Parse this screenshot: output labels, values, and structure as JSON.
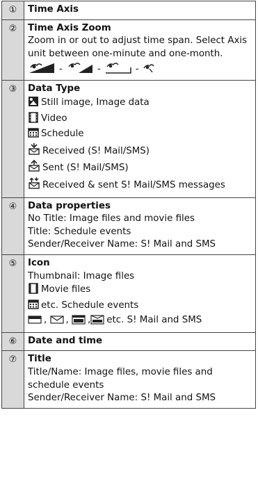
{
  "rows": [
    {
      "num": "①",
      "title": "Time Axis"
    },
    {
      "num": "②",
      "title": "Time Axis Zoom",
      "desc": "Zoom in or out to adjust time span. Select Axis unit between one-minute and one-month.",
      "sep": "-"
    },
    {
      "num": "③",
      "title": "Data Type",
      "items": [
        {
          "icon": "still-image-icon",
          "text": "Still image, Image data"
        },
        {
          "icon": "video-icon",
          "text": "Video"
        },
        {
          "icon": "schedule-icon",
          "text": "Schedule"
        },
        {
          "icon": "received-mail-icon",
          "text": "Received (S! Mail/SMS)"
        },
        {
          "icon": "sent-mail-icon",
          "text": "Sent (S! Mail/SMS)"
        },
        {
          "icon": "received-sent-mail-icon",
          "text": "Received & sent S! Mail/SMS messages"
        }
      ]
    },
    {
      "num": "④",
      "title": "Data properties",
      "lines": [
        "No Title: Image files and movie files",
        "Title: Schedule events",
        "Sender/Receiver Name: S! Mail and SMS"
      ]
    },
    {
      "num": "⑤",
      "title": "Icon",
      "lines": [
        "Thumbnail: Image files",
        "Movie files",
        "etc. Schedule events",
        ", ",
        ",",
        "etc. S! Mail and SMS"
      ]
    },
    {
      "num": "⑥",
      "title": "Date and time"
    },
    {
      "num": "⑦",
      "title": "Title",
      "lines": [
        "Title/Name: Image files, movie files and schedule events",
        "Sender/Receiver Name: S! Mail and SMS"
      ]
    }
  ]
}
